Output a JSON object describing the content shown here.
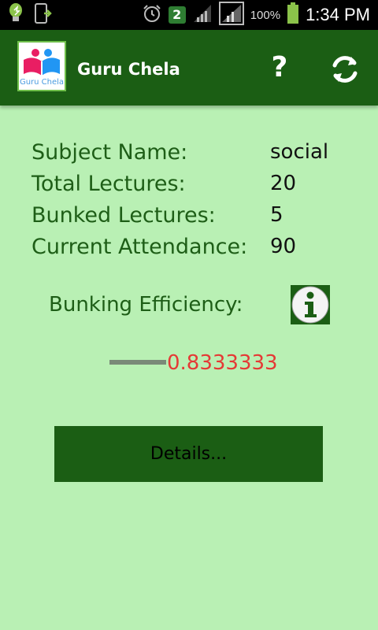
{
  "status_bar": {
    "notification_count": "2",
    "battery_percent": "100%",
    "time": "1:34 PM"
  },
  "app": {
    "logo_text": "Guru Chela",
    "title": "Guru Chela",
    "help_label": "?"
  },
  "info": {
    "subject_label": "Subject Name:",
    "subject_value": "social",
    "total_label": "Total Lectures:",
    "total_value": "20",
    "bunked_label": "Bunked Lectures:",
    "bunked_value": "5",
    "attendance_label": "Current Attendance:",
    "attendance_value": "90"
  },
  "efficiency": {
    "label": "Bunking Efficiency:",
    "value": "0.8333333"
  },
  "details_button": "Details..."
}
